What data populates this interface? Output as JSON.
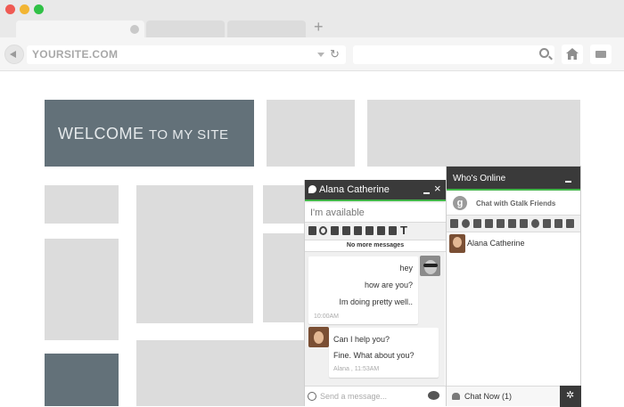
{
  "browser": {
    "address": "YOURSITE.COM",
    "new_tab_symbol": "+",
    "reload_symbol": "↻"
  },
  "page": {
    "welcome_big": "WELCOME",
    "welcome_small": "TO MY SITE"
  },
  "chat": {
    "contact_name": "Alana Catherine",
    "close_symbol": "×",
    "status": "I'm available",
    "no_more": "No more messages",
    "sent": {
      "lines": [
        "hey",
        "how are you?",
        "Im doing pretty well.."
      ],
      "time": "10:00AM"
    },
    "received": {
      "lines": [
        "Can I help you?",
        "Fine. What about you?"
      ],
      "time": "Alana ,  11:53AM"
    },
    "input_placeholder": "Send a message..."
  },
  "who": {
    "title": "Who's Online",
    "gtalk_label": "Chat with Gtalk Friends",
    "gtalk_icon_letter": "g",
    "contacts": [
      "Alana Catherine"
    ],
    "footer": "Chat Now (1)"
  },
  "colors": {
    "accent_green": "#43b64a",
    "header_dark": "#3a3a3a",
    "slate": "#637179"
  }
}
